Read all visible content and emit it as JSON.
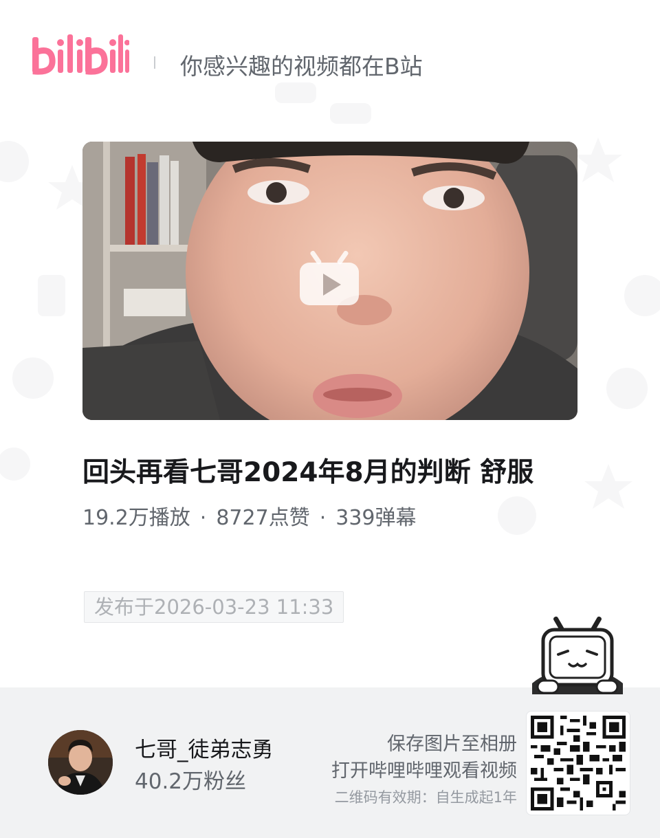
{
  "header": {
    "logo_text": "bilibili",
    "slogan": "你感兴趣的视频都在B站"
  },
  "video": {
    "title": "回头再看七哥2024年8月的判断 舒服",
    "plays": "19.2万播放",
    "likes": "8727点赞",
    "danmaku": "339弹幕",
    "separator": "·",
    "publish_date": "发布于2026-03-23 11:33"
  },
  "uploader": {
    "name": "七哥_徒弟志勇",
    "fans": "40.2万粉丝"
  },
  "share": {
    "hint_line1": "保存图片至相册",
    "hint_line2": "打开哔哩哔哩观看视频",
    "qr_validity": "二维码有效期：自生成起1年"
  },
  "icons": {
    "play": "play-tv-icon",
    "mascot": "bilibili-tv-mascot-icon",
    "qr": "qr-code"
  },
  "colors": {
    "brand_pink": "#fb7299",
    "footer_bg": "#f1f2f3"
  }
}
